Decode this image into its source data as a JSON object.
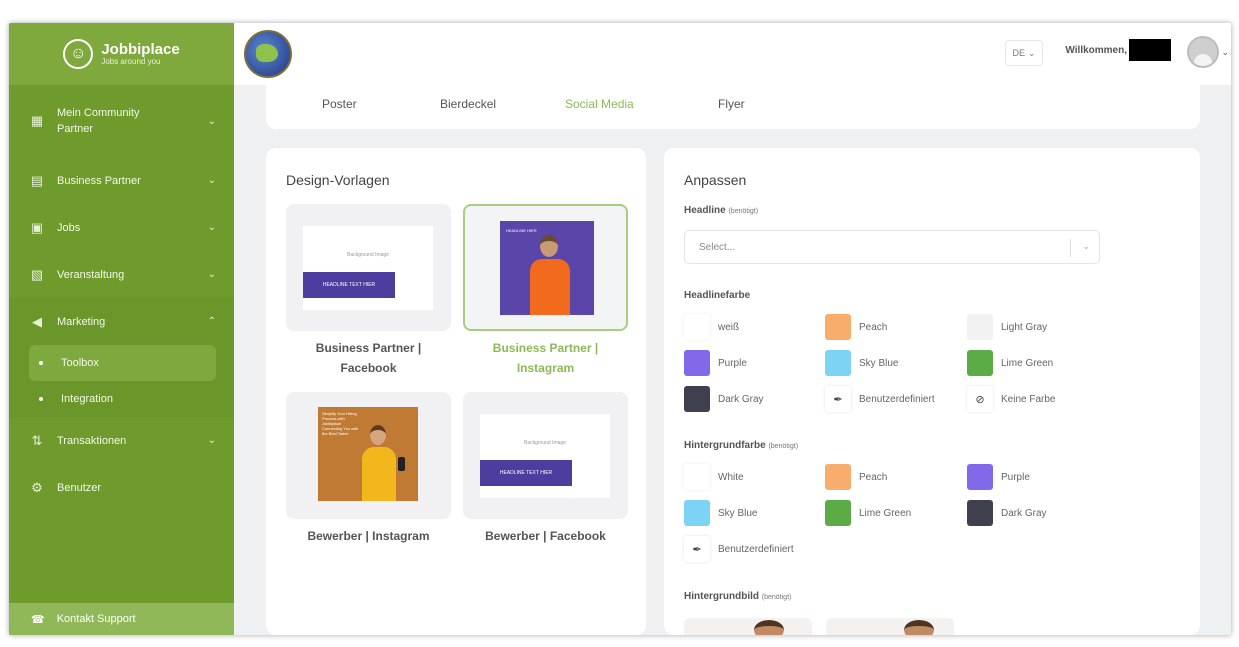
{
  "brand": {
    "name": "Jobbiplace",
    "tagline": "Jobs around you"
  },
  "sidebar": {
    "items": [
      {
        "label": "Mein Community Partner",
        "icon": "building-icon"
      },
      {
        "label": "Business Partner",
        "icon": "office-icon"
      },
      {
        "label": "Jobs",
        "icon": "briefcase-icon"
      },
      {
        "label": "Veranstaltung",
        "icon": "calendar-icon"
      },
      {
        "label": "Marketing",
        "icon": "megaphone-icon",
        "expanded": true
      },
      {
        "label": "Transaktionen",
        "icon": "arrows-icon"
      },
      {
        "label": "Benutzer",
        "icon": "users-icon"
      }
    ],
    "sub": [
      {
        "label": "Toolbox",
        "active": true
      },
      {
        "label": "Integration"
      }
    ],
    "support": "Kontakt Support"
  },
  "header": {
    "language": "DE",
    "welcome": "Willkommen,"
  },
  "tabs": [
    "Poster",
    "Bierdeckel",
    "Social Media",
    "Flyer"
  ],
  "active_tab": "Social Media",
  "design": {
    "title": "Design-Vorlagen",
    "preview_bg_text": "Background Image",
    "preview_headline": "HEADLINE TEXT HIER",
    "ig_headline": "HEADLINE HIER",
    "bw_headline": "Simplify Your Hiring Process with Jobbiplace Connecting You with the Best Talent",
    "templates": [
      {
        "title": "Business Partner | Facebook"
      },
      {
        "title": "Business Partner | Instagram",
        "selected": true
      },
      {
        "title": "Bewerber | Instagram"
      },
      {
        "title": "Bewerber | Facebook"
      }
    ]
  },
  "customize": {
    "title": "Anpassen",
    "headline_label": "Headline",
    "required": "(benötigt)",
    "select_placeholder": "Select...",
    "headline_color_label": "Headlinefarbe",
    "headline_colors": [
      {
        "label": "weiß",
        "color": "#ffffff"
      },
      {
        "label": "Peach",
        "color": "#f8ad6c"
      },
      {
        "label": "Light Gray",
        "color": "#f2f2f2"
      },
      {
        "label": "Purple",
        "color": "#8269ea"
      },
      {
        "label": "Sky Blue",
        "color": "#7dd3f3"
      },
      {
        "label": "Lime Green",
        "color": "#5bab46"
      },
      {
        "label": "Dark Gray",
        "color": "#3f3f4d"
      },
      {
        "label": "Benutzerdefiniert",
        "icon": "eyedropper-icon"
      },
      {
        "label": "Keine Farbe",
        "icon": "no-color-icon"
      }
    ],
    "bg_color_label": "Hintergrundfarbe",
    "bg_colors": [
      {
        "label": "White",
        "color": "#ffffff"
      },
      {
        "label": "Peach",
        "color": "#f8ad6c"
      },
      {
        "label": "Purple",
        "color": "#8269ea"
      },
      {
        "label": "Sky Blue",
        "color": "#7dd3f3"
      },
      {
        "label": "Lime Green",
        "color": "#5bab46"
      },
      {
        "label": "Dark Gray",
        "color": "#3f3f4d"
      },
      {
        "label": "Benutzerdefiniert",
        "icon": "eyedropper-icon"
      }
    ],
    "bg_image_label": "Hintergrundbild"
  },
  "colors": {
    "sidebar": "#6e9b2c",
    "accent": "#8cba56"
  }
}
